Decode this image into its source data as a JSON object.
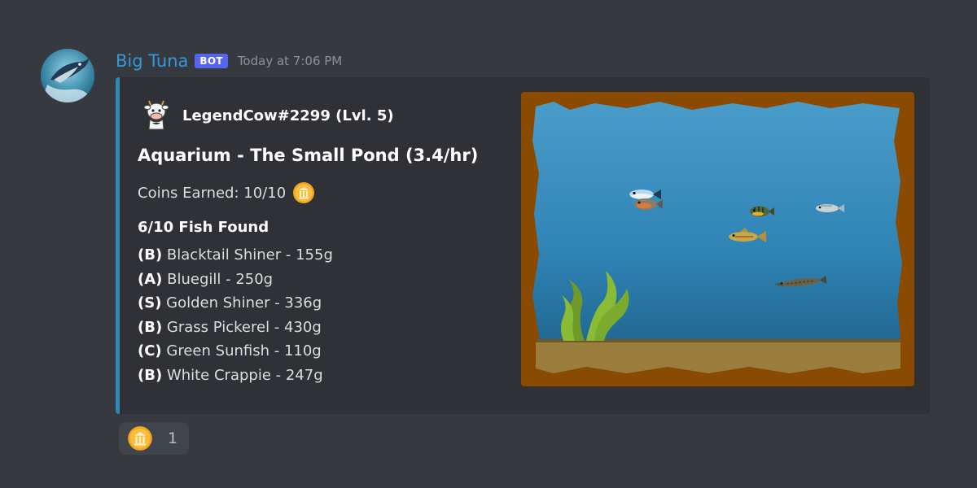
{
  "message": {
    "username": "Big Tuna",
    "badge": "BOT",
    "timestamp": "Today at 7:06 PM",
    "avatar_icon": "tuna-avatar-icon"
  },
  "embed": {
    "accent_color": "#2e87b5",
    "author": {
      "name": "LegendCow#2299 (Lvl. 5)",
      "icon": "cow-icon"
    },
    "title": "Aquarium - The Small Pond (3.4/hr)",
    "coins_text": "Coins Earned: 10/10",
    "coin_icon": "coin-icon",
    "fish_heading": "6/10 Fish Found",
    "fish": [
      {
        "rarity": "(B)",
        "text": "Blacktail Shiner - 155g"
      },
      {
        "rarity": "(A)",
        "text": "Bluegill - 250g"
      },
      {
        "rarity": "(S)",
        "text": "Golden Shiner - 336g"
      },
      {
        "rarity": "(B)",
        "text": "Grass Pickerel - 430g"
      },
      {
        "rarity": "(C)",
        "text": "Green Sunfish - 110g"
      },
      {
        "rarity": "(B)",
        "text": "White Crappie - 247g"
      }
    ]
  },
  "reaction": {
    "icon": "coin-icon",
    "count": "1"
  }
}
